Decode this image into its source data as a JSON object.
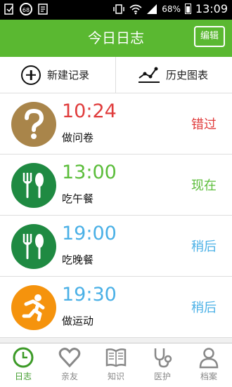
{
  "status_bar": {
    "badge": "68",
    "battery_pct": "68%",
    "time": "13:09"
  },
  "header": {
    "title": "今日日志",
    "edit_label": "编辑"
  },
  "actions": {
    "new_record": "新建记录",
    "history_chart": "历史图表"
  },
  "items": [
    {
      "time": "10:24",
      "name": "做问卷",
      "state": "错过",
      "icon": "question-icon",
      "time_color": "#e03c3c",
      "state_color": "#e03c3c",
      "icon_bg": "#a9854a"
    },
    {
      "time": "13:00",
      "name": "吃午餐",
      "state": "现在",
      "icon": "utensils-icon",
      "time_color": "#5bbd3a",
      "state_color": "#5bbd3a",
      "icon_bg": "#1f8a42"
    },
    {
      "time": "19:00",
      "name": "吃晚餐",
      "state": "稍后",
      "icon": "utensils-icon",
      "time_color": "#4ab0e6",
      "state_color": "#4ab0e6",
      "icon_bg": "#1f8a42"
    },
    {
      "time": "19:30",
      "name": "做运动",
      "state": "稍后",
      "icon": "running-icon",
      "time_color": "#4ab0e6",
      "state_color": "#4ab0e6",
      "icon_bg": "#f5930d"
    }
  ],
  "tabs": [
    {
      "label": "日志",
      "icon": "clock-icon",
      "active": true
    },
    {
      "label": "亲友",
      "icon": "heart-icon",
      "active": false
    },
    {
      "label": "知识",
      "icon": "book-icon",
      "active": false
    },
    {
      "label": "医护",
      "icon": "stethoscope-icon",
      "active": false
    },
    {
      "label": "档案",
      "icon": "person-icon",
      "active": false
    }
  ],
  "colors": {
    "brand_green": "#5ab831",
    "active_tab": "#3c9a27",
    "inactive_tab": "#888888"
  }
}
